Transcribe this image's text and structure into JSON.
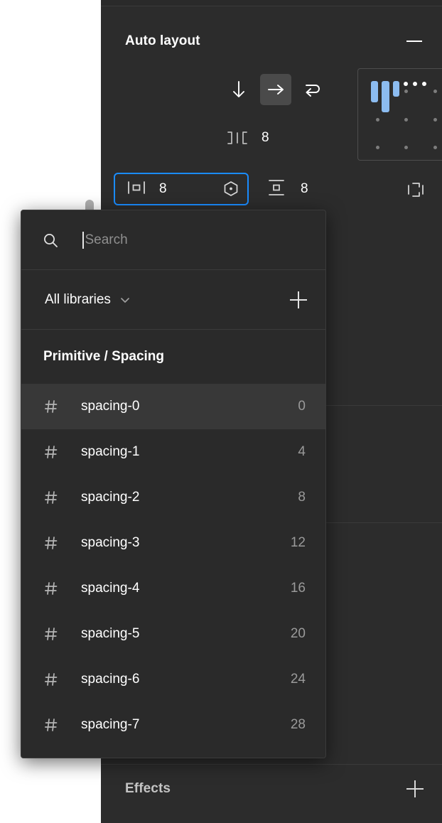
{
  "canvas": {
    "scrollbar": "vertical-scrollbar"
  },
  "panel": {
    "autolayout": {
      "title": "Auto layout",
      "minimize_label": "—",
      "more_label": "…",
      "directions": [
        {
          "name": "vertical",
          "glyph": "↓",
          "active": false
        },
        {
          "name": "horizontal",
          "glyph": "→",
          "active": true
        },
        {
          "name": "wrap",
          "glyph": "⤶",
          "active": false
        }
      ],
      "gap": {
        "label": "Gap between items",
        "value": "8"
      },
      "horizontal_padding": {
        "label": "Horizontal padding",
        "value": "8",
        "focused": true
      },
      "vertical_padding": {
        "label": "Vertical padding",
        "value": "8"
      },
      "individual_padding_label": "Individual padding",
      "alignment": {
        "label": "Alignment",
        "selected": "top-left"
      }
    },
    "effects": {
      "title": "Effects",
      "add_label": "+"
    }
  },
  "dropdown": {
    "search": {
      "placeholder": "Search",
      "value": ""
    },
    "libraries": {
      "label": "All libraries",
      "add_label": "+"
    },
    "group_title": "Primitive / Spacing",
    "items": [
      {
        "name": "spacing-0",
        "value": "0",
        "selected": true
      },
      {
        "name": "spacing-1",
        "value": "4",
        "selected": false
      },
      {
        "name": "spacing-2",
        "value": "8",
        "selected": false
      },
      {
        "name": "spacing-3",
        "value": "12",
        "selected": false
      },
      {
        "name": "spacing-4",
        "value": "16",
        "selected": false
      },
      {
        "name": "spacing-5",
        "value": "20",
        "selected": false
      },
      {
        "name": "spacing-6",
        "value": "24",
        "selected": false
      },
      {
        "name": "spacing-7",
        "value": "28",
        "selected": false
      }
    ]
  },
  "colors": {
    "panel_bg": "#2c2c2c",
    "dropdown_bg": "#2a2a2a",
    "row_selected": "#383838",
    "accent": "#1a8cff",
    "align_bar": "#8cbcf0",
    "muted_text": "#9a9a9a"
  }
}
